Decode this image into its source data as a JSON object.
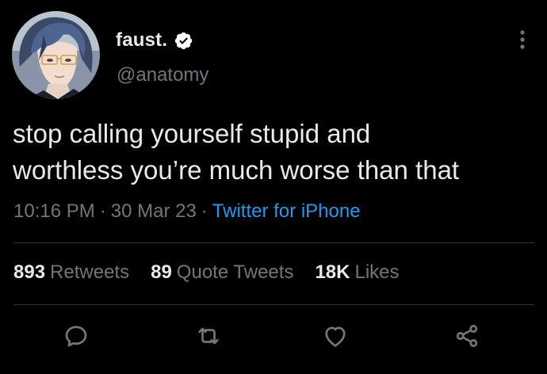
{
  "user": {
    "display_name": "faust.",
    "handle": "@anatomy",
    "verified": true
  },
  "tweet": {
    "text": "stop calling yourself stupid and\nworthless you’re much worse than that",
    "time": "10:16 PM",
    "date": "30 Mar 23",
    "source": "Twitter for iPhone",
    "separator": "·"
  },
  "stats": [
    {
      "count": "893",
      "label": "Retweets"
    },
    {
      "count": "89",
      "label": "Quote Tweets"
    },
    {
      "count": "18K",
      "label": "Likes"
    }
  ],
  "actions": [
    {
      "name": "reply",
      "icon": "comment-icon"
    },
    {
      "name": "retweet",
      "icon": "retweet-icon"
    },
    {
      "name": "like",
      "icon": "heart-icon"
    },
    {
      "name": "share",
      "icon": "share-icon"
    }
  ],
  "colors": {
    "background": "#000000",
    "primary_text": "#e7e9ea",
    "secondary_text": "#71767b",
    "link": "#1d9bf0",
    "divider": "#2f3336"
  }
}
